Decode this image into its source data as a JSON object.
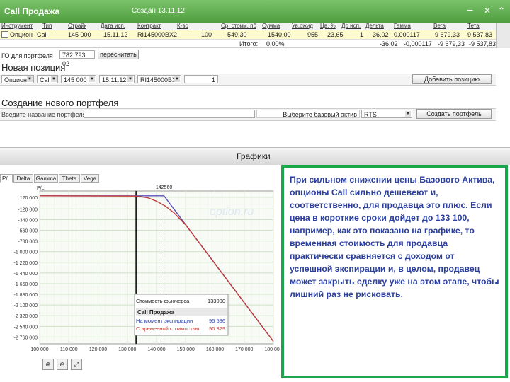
{
  "window": {
    "title": "Call Продажа",
    "date_label": "Создан 13.11.12"
  },
  "grid": {
    "headers": [
      "Инструмент",
      "Тип",
      "Страйк",
      "Дата исп.",
      "Контракт",
      "К-во",
      "Ср. стоим. пб",
      "Сумма",
      "Ув.ожид",
      "Цв. %",
      "До исп.",
      "Дельта",
      "Гамма",
      "Вега",
      "Тета"
    ],
    "row1": [
      "Опцион",
      "Call",
      "145 000",
      "15.11.12",
      "RI145000BX2",
      "100",
      "-549,30",
      "1540,00",
      "955",
      "23,65",
      "1",
      "36,02",
      "0,000117",
      "9 679,33",
      "9 537,83"
    ],
    "row2_label": "Итого:",
    "row2": [
      "0,00%",
      "-36,02",
      "-0,000117",
      "-9 679,33",
      "-9 537,83"
    ]
  },
  "portfolio": {
    "label": "ГО для портфеля",
    "value": "782 793 02",
    "recalc": "пересчитать"
  },
  "new_position": {
    "title": "Новая позиция",
    "fields": [
      "Опцион",
      "Call",
      "145 000",
      "15.11.12",
      "RI145000BX2",
      "1"
    ],
    "add_button": "Добавить позицию"
  },
  "new_portfolio": {
    "title": "Создание нового портфеля",
    "name_placeholder": "Введите название портфеля",
    "base_label": "Выберите базовый актив",
    "base_value": "RTS",
    "create_button": "Создать портфель"
  },
  "charts": {
    "title": "Графики",
    "tabs": [
      "P/L",
      "Delta",
      "Gamma",
      "Theta",
      "Vega"
    ],
    "active_tab": 0,
    "ylabel": "P/L",
    "strike_label": "142560",
    "watermark": "option.ru",
    "info": {
      "futures_label": "Стоимость фьючерса",
      "futures_value": "133000",
      "header": "Call Продажа",
      "expiry_label": "На момент экспирации",
      "expiry_value": "95 536",
      "time_label": "С временной стоимостью",
      "time_value": "90 329"
    }
  },
  "chart_data": {
    "type": "line",
    "xlim": [
      100000,
      180000
    ],
    "ylim": [
      -2900000,
      250000
    ],
    "x_ticks": [
      "100 000",
      "110 000",
      "120 000",
      "130 000",
      "140 000",
      "150 000",
      "160 000",
      "170 000",
      "180 000"
    ],
    "y_ticks": [
      "120 000",
      "-120 000",
      "-340 000",
      "-560 000",
      "-780 000",
      "-1 000 000",
      "-1 220 000",
      "-1 440 000",
      "-1 660 000",
      "-1 880 000",
      "-2 100 000",
      "-2 320 000",
      "-2 540 000",
      "-2 760 000"
    ],
    "series": [
      {
        "color": "#5a4fb5",
        "x": [
          100000,
          142560,
          180000
        ],
        "y": [
          150000,
          150000,
          -2850000
        ]
      },
      {
        "color": "#c03a3a",
        "x": [
          100000,
          133000,
          137000,
          140000,
          143000,
          146000,
          150000,
          180000
        ],
        "y": [
          150000,
          145000,
          110000,
          40000,
          -60000,
          -200000,
          -450000,
          -2850000
        ]
      }
    ]
  },
  "note": {
    "text": "При сильном снижении цены Базового Актива, опционы Call сильно дешевеют и, соответственно, для продавца это плюс. Если цена в короткие сроки дойдет до 133 100, например, как это показано на графике, то временная стоимость для продавца практически сравняется с доходом от успешной экспирации и, в целом, продавец может закрыть сделку уже на этом этапе, чтобы лишний раз не рисковать."
  },
  "colors": {
    "accent": "#4f9e3f",
    "note_border": "#1aa64a",
    "note_text": "#2a3fa0"
  }
}
